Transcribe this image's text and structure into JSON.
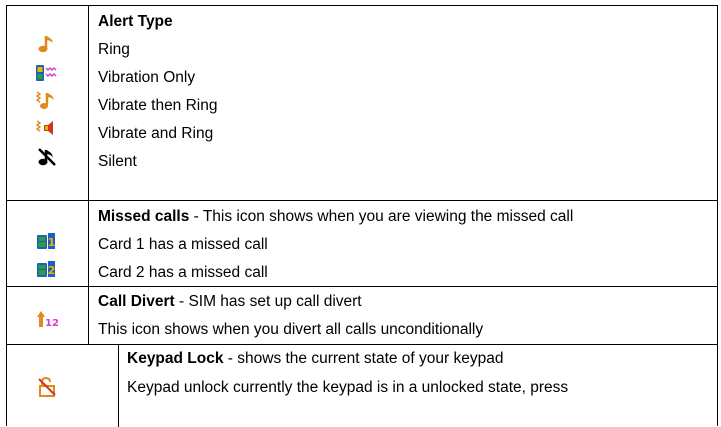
{
  "rows": [
    {
      "id": "alert-type",
      "lines": [
        {
          "bold": "Alert Type",
          "rest": ""
        },
        {
          "bold": "",
          "rest": "Ring"
        },
        {
          "bold": "",
          "rest": "Vibration Only"
        },
        {
          "bold": "",
          "rest": "Vibrate then Ring"
        },
        {
          "bold": "",
          "rest": "Vibrate and Ring"
        },
        {
          "bold": "",
          "rest": "Silent"
        }
      ],
      "icons": [
        "ring-icon",
        "vibration-only-icon",
        "vibrate-then-ring-icon",
        "vibrate-and-ring-icon",
        "silent-icon"
      ]
    },
    {
      "id": "missed-calls",
      "lines": [
        {
          "bold": "Missed calls",
          "rest": " - This icon shows when you are viewing the missed call"
        },
        {
          "bold": "",
          "rest": "Card 1 has a missed call"
        },
        {
          "bold": "",
          "rest": "Card 2 has a missed call"
        }
      ],
      "icons": [
        "missed-call-card1-icon",
        "missed-call-card2-icon"
      ]
    },
    {
      "id": "call-divert",
      "lines": [
        {
          "bold": "Call Divert",
          "rest": " - SIM has set up call divert"
        },
        {
          "bold": "",
          "rest": "This icon shows when you divert all calls unconditionally"
        }
      ],
      "icons": [
        "call-divert-icon"
      ]
    },
    {
      "id": "keypad-lock",
      "lines": [
        {
          "bold": "Keypad Lock",
          "rest": " - shows the current state of your keypad"
        },
        {
          "bold": "",
          "rest": "Keypad unlock currently the keypad is in a unlocked state, press"
        }
      ],
      "icons": [
        "keypad-unlock-icon"
      ]
    }
  ],
  "icon_labels": {
    "card1_digit": "1",
    "card2_digit": "2",
    "divert_digits": "12"
  },
  "colors": {
    "note_orange": "#e08a1e",
    "phone_blue": "#1f5fc0",
    "phone_green": "#2e9e3a",
    "magenta": "#d13cd1",
    "yellow": "#e8b800",
    "red": "#d6331f"
  }
}
